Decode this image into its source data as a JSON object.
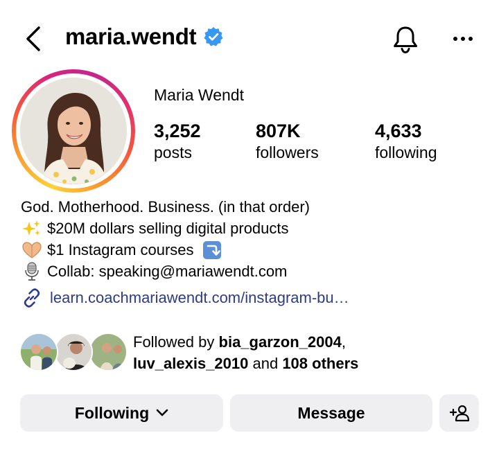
{
  "header": {
    "handle": "maria.wendt",
    "verified_color": "#3897f0"
  },
  "profile": {
    "full_name": "Maria Wendt",
    "stats": [
      {
        "value": "3,252",
        "label": "posts"
      },
      {
        "value": "807K",
        "label": "followers"
      },
      {
        "value": "4,633",
        "label": "following"
      }
    ]
  },
  "bio": {
    "line1": "God. Motherhood. Business. (in that order)",
    "line2": "$20M dollars selling digital products",
    "line3": "$1 Instagram courses",
    "line4": "Collab: speaking@mariawendt.com",
    "link": "learn.coachmariawendt.com/instagram-bu…",
    "link_color": "#2e3b87"
  },
  "followed_by": {
    "prefix": "Followed by ",
    "user1": "bia_garzon_2004",
    "comma": ",",
    "user2": "luv_alexis_2010",
    "and": " and ",
    "others": "108 others"
  },
  "actions": {
    "following_label": "Following",
    "message_label": "Message"
  },
  "icons": {
    "back": "chevron-left-icon",
    "verified": "verified-badge-icon",
    "bell": "bell-icon",
    "more": "more-horizontal-icon",
    "sparkles": "sparkles-emoji-icon",
    "heart_hands": "heart-hands-emoji-icon",
    "arrow_down": "arrow-curving-down-emoji-icon",
    "microphone": "studio-microphone-emoji-icon",
    "link": "link-icon",
    "chevron_down": "chevron-down-icon",
    "add_person": "add-person-icon"
  }
}
